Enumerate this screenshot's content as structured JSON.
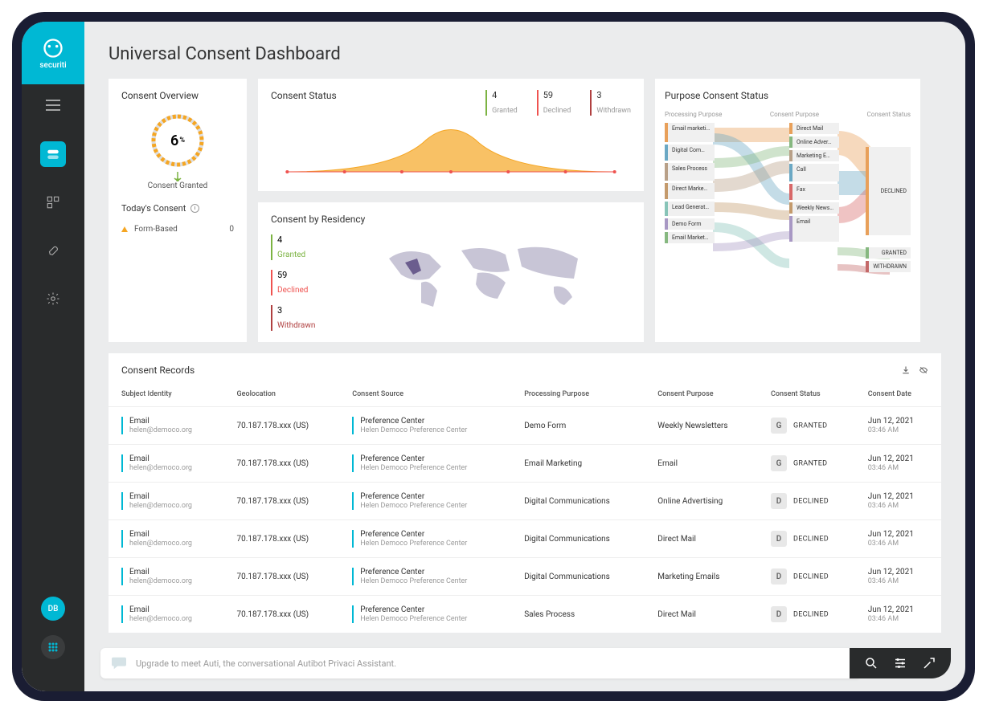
{
  "brand": "securiti",
  "page_title": "Universal Consent Dashboard",
  "overview": {
    "title": "Consent Overview",
    "gauge_value": "6",
    "gauge_unit": "%",
    "gauge_label": "Consent Granted",
    "today_label": "Today's Consent",
    "metric_label": "Form-Based",
    "metric_value": "0"
  },
  "status": {
    "title": "Consent Status",
    "granted": {
      "value": "4",
      "label": "Granted"
    },
    "declined": {
      "value": "59",
      "label": "Declined"
    },
    "withdrawn": {
      "value": "3",
      "label": "Withdrawn"
    }
  },
  "residency": {
    "title": "Consent by Residency",
    "granted": {
      "value": "4",
      "label": "Granted"
    },
    "declined": {
      "value": "59",
      "label": "Declined"
    },
    "withdrawn": {
      "value": "3",
      "label": "Withdrawn"
    }
  },
  "sankey": {
    "title": "Purpose Consent Status",
    "col_headers": [
      "Processing Purpose",
      "Consent Purpose",
      "Consent Status"
    ],
    "left": [
      "Email marketi…",
      "Digital Com…",
      "Sales Process",
      "Direct Marke…",
      "Lead Generat…",
      "Demo Form",
      "Email Market…"
    ],
    "mid": [
      "Direct Mail",
      "Online Adver…",
      "Marketing E…",
      "Call",
      "Fax",
      "Weekly News…",
      "Email"
    ],
    "right": [
      "DECLINED",
      "GRANTED",
      "WITHDRAWN"
    ]
  },
  "records": {
    "title": "Consent Records",
    "columns": [
      "Subject Identity",
      "Geolocation",
      "Consent Source",
      "Processing Purpose",
      "Consent Purpose",
      "Consent Status",
      "Consent Date"
    ],
    "rows": [
      {
        "identity_type": "Email",
        "identity": "helen@democo.org",
        "geo": "70.187.178.xxx (US)",
        "src": "Preference Center",
        "src_sub": "Helen Democo Preference Center",
        "purpose": "Demo Form",
        "consent_purpose": "Weekly Newsletters",
        "status_badge": "G",
        "status": "GRANTED",
        "date": "Jun 12, 2021",
        "time": "03:46 AM"
      },
      {
        "identity_type": "Email",
        "identity": "helen@democo.org",
        "geo": "70.187.178.xxx (US)",
        "src": "Preference Center",
        "src_sub": "Helen Democo Preference Center",
        "purpose": "Email Marketing",
        "consent_purpose": "Email",
        "status_badge": "G",
        "status": "GRANTED",
        "date": "Jun 12, 2021",
        "time": "03:46 AM"
      },
      {
        "identity_type": "Email",
        "identity": "helen@democo.org",
        "geo": "70.187.178.xxx (US)",
        "src": "Preference Center",
        "src_sub": "Helen Democo Preference Center",
        "purpose": "Digital Communications",
        "consent_purpose": "Online Advertising",
        "status_badge": "D",
        "status": "DECLINED",
        "date": "Jun 12, 2021",
        "time": "03:46 AM"
      },
      {
        "identity_type": "Email",
        "identity": "helen@democo.org",
        "geo": "70.187.178.xxx (US)",
        "src": "Preference Center",
        "src_sub": "Helen Democo Preference Center",
        "purpose": "Digital Communications",
        "consent_purpose": "Direct Mail",
        "status_badge": "D",
        "status": "DECLINED",
        "date": "Jun 12, 2021",
        "time": "03:46 AM"
      },
      {
        "identity_type": "Email",
        "identity": "helen@democo.org",
        "geo": "70.187.178.xxx (US)",
        "src": "Preference Center",
        "src_sub": "Helen Democo Preference Center",
        "purpose": "Digital Communications",
        "consent_purpose": "Marketing Emails",
        "status_badge": "D",
        "status": "DECLINED",
        "date": "Jun 12, 2021",
        "time": "03:46 AM"
      },
      {
        "identity_type": "Email",
        "identity": "helen@democo.org",
        "geo": "70.187.178.xxx (US)",
        "src": "Preference Center",
        "src_sub": "Helen Democo Preference Center",
        "purpose": "Sales Process",
        "consent_purpose": "Direct Mail",
        "status_badge": "D",
        "status": "DECLINED",
        "date": "Jun 12, 2021",
        "time": "03:46 AM"
      }
    ]
  },
  "footer_text": "Upgrade to meet Auti, the conversational Autibot Privaci Assistant.",
  "avatar": "DB"
}
